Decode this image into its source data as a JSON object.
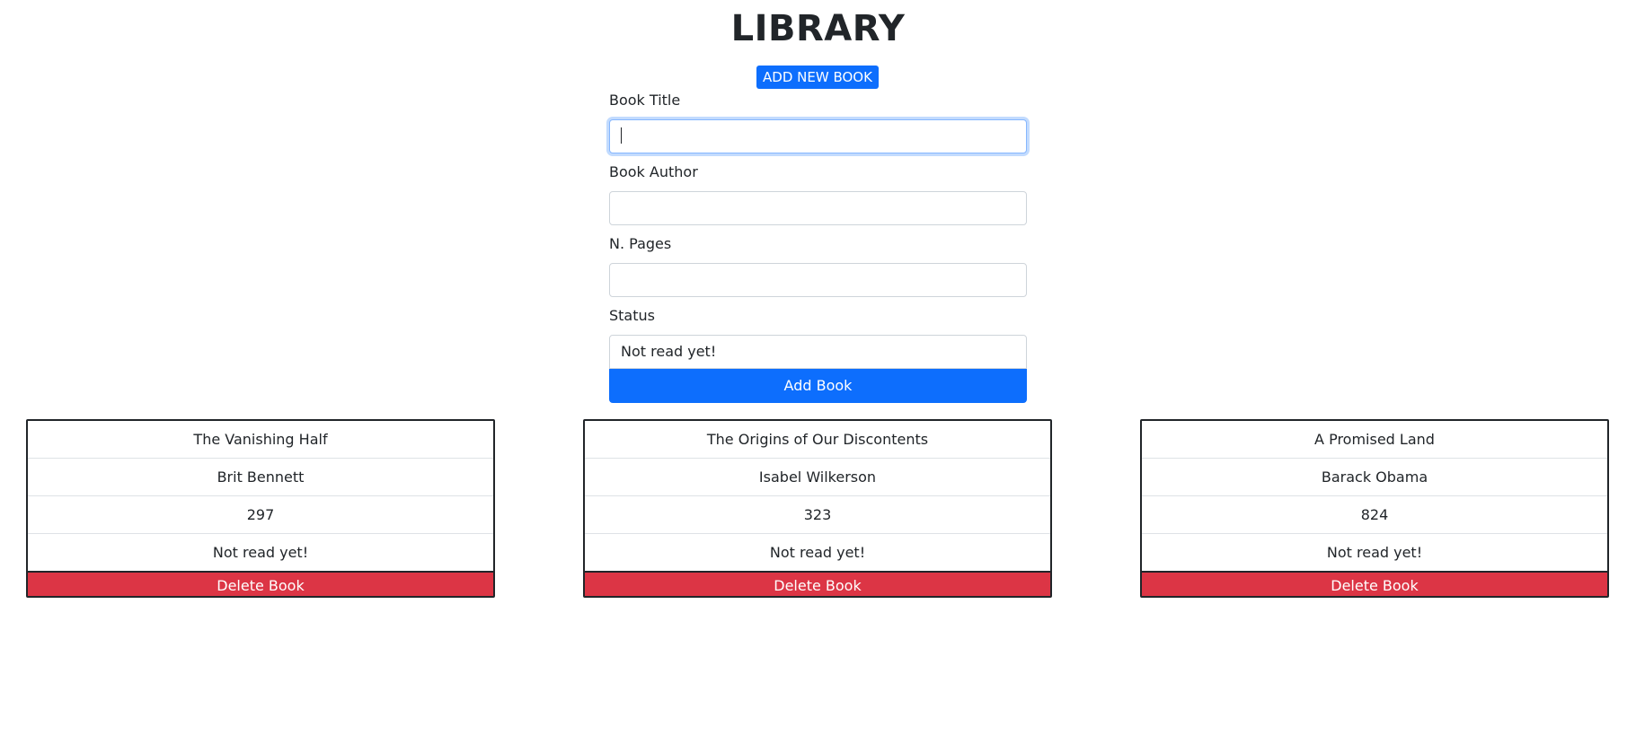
{
  "header": {
    "title": "LIBRARY",
    "add_new_label": "ADD NEW BOOK"
  },
  "form": {
    "title_label": "Book Title",
    "title_value": "",
    "author_label": "Book Author",
    "author_value": "",
    "pages_label": "N. Pages",
    "pages_value": "",
    "status_label": "Status",
    "status_selected": "Not read yet!",
    "submit_label": "Add Book"
  },
  "books": [
    {
      "title": "The Vanishing Half",
      "author": "Brit Bennett",
      "pages": "297",
      "status": "Not read yet!",
      "delete_label": "Delete Book"
    },
    {
      "title": "The Origins of Our Discontents",
      "author": "Isabel Wilkerson",
      "pages": "323",
      "status": "Not read yet!",
      "delete_label": "Delete Book"
    },
    {
      "title": "A Promised Land",
      "author": "Barack Obama",
      "pages": "824",
      "status": "Not read yet!",
      "delete_label": "Delete Book"
    }
  ],
  "colors": {
    "primary": "#0d6efd",
    "danger": "#dc3545",
    "text": "#212529"
  }
}
